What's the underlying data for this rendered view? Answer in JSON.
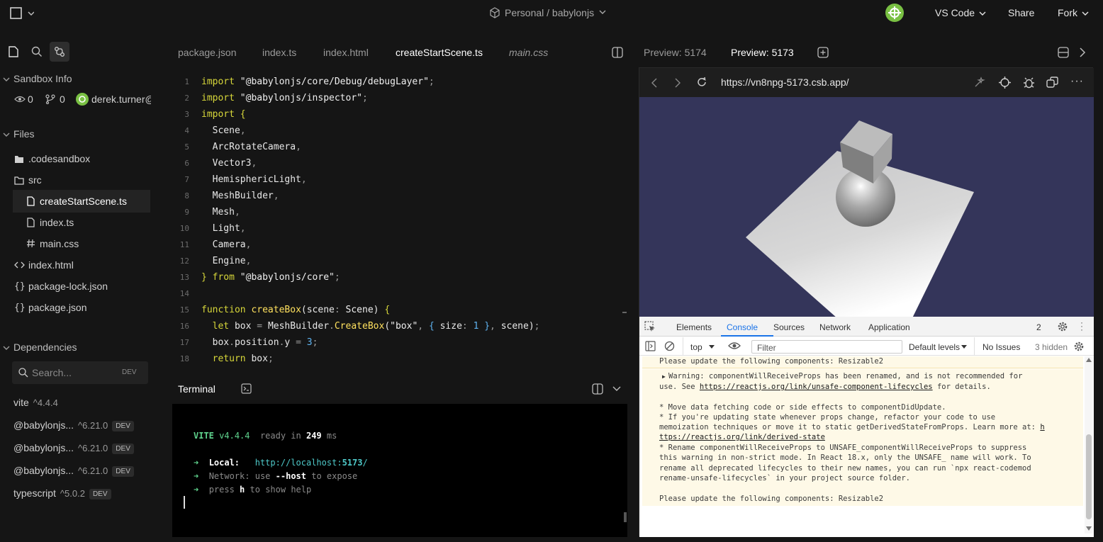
{
  "topbar": {
    "breadcrumb": "Personal / babylonjs",
    "editor_label": "VS Code",
    "share_label": "Share",
    "fork_label": "Fork"
  },
  "sidebar": {
    "sandbox_info_title": "Sandbox Info",
    "views": "0",
    "forks": "0",
    "author": "derek.turner@",
    "files_title": "Files",
    "files": [
      {
        "name": ".codesandbox",
        "icon": "folder-icon"
      },
      {
        "name": "src",
        "icon": "folder-open-icon"
      },
      {
        "name": "createStartScene.ts",
        "icon": "file-icon"
      },
      {
        "name": "index.ts",
        "icon": "file-icon"
      },
      {
        "name": "main.css",
        "icon": "hash-icon"
      },
      {
        "name": "index.html",
        "icon": "code-icon"
      },
      {
        "name": "package-lock.json",
        "icon": "braces-icon"
      },
      {
        "name": "package.json",
        "icon": "braces-icon"
      }
    ],
    "dependencies_title": "Dependencies",
    "search_placeholder": "Search...",
    "search_badge": "DEV",
    "dependencies": [
      {
        "name": "vite",
        "version": "^4.4.4",
        "dev": ""
      },
      {
        "name": "@babylonjs...",
        "version": "^6.21.0",
        "dev": "DEV"
      },
      {
        "name": "@babylonjs...",
        "version": "^6.21.0",
        "dev": "DEV"
      },
      {
        "name": "@babylonjs...",
        "version": "^6.21.0",
        "dev": "DEV"
      },
      {
        "name": "typescript",
        "version": "^5.0.2",
        "dev": "DEV"
      }
    ]
  },
  "editor": {
    "tabs": [
      "package.json",
      "index.ts",
      "index.html",
      "createStartScene.ts",
      "main.css"
    ],
    "active_tab": "createStartScene.ts",
    "line_numbers": [
      "1",
      "2",
      "3",
      "4",
      "5",
      "6",
      "7",
      "8",
      "9",
      "10",
      "11",
      "12",
      "13",
      "14",
      "15",
      "16",
      "17",
      "18"
    ]
  },
  "terminal": {
    "title": "Terminal",
    "vite": "VITE",
    "vite_version": "v4.4.4",
    "ready_text": "ready in",
    "ready_ms": "249",
    "ms_unit": "ms",
    "local_label": "Local:",
    "local_url_a": "http://localhost:",
    "local_url_port": "5173",
    "local_url_b": "/",
    "network_label": "Network:",
    "network_a": "use",
    "network_flag": "--host",
    "network_b": "to expose",
    "help_a": "press",
    "help_key": "h",
    "help_b": "to show help"
  },
  "preview": {
    "tabs": [
      "Preview: 5174",
      "Preview: 5173"
    ],
    "active_tab": "Preview: 5173",
    "url": "https://vn8npg-5173.csb.app/"
  },
  "devtools": {
    "tabs": [
      "Elements",
      "Console",
      "Sources",
      "Network",
      "Application"
    ],
    "active_tab": "Console",
    "issue_count": "2",
    "context": "top",
    "filter_placeholder": "Filter",
    "levels": "Default levels",
    "no_issues": "No Issues",
    "hidden": "3 hidden",
    "msg1": "Please update the following components: Resizable2",
    "warn_line1": "Warning: componentWillReceiveProps has been renamed, and is not recommended for",
    "warn_line2_a": "use. See",
    "warn_link1": "https://reactjs.org/link/unsafe-component-lifecycles",
    "warn_line2_b": "for details.",
    "warn_line3": "* Move data fetching code or side effects to componentDidUpdate.",
    "warn_line4": "* If you're updating state whenever props change, refactor your code to use",
    "warn_line5_a": "memoization techniques or move it to static getDerivedStateFromProps. Learn more at:",
    "warn_line5_b": "h",
    "warn_link2": "ttps://reactjs.org/link/derived-state",
    "warn_line6": "* Rename componentWillReceiveProps to UNSAFE_componentWillReceiveProps to suppress",
    "warn_line7": "this warning in non-strict mode. In React 18.x, only the UNSAFE_ name will work. To",
    "warn_line8": "rename all deprecated lifecycles to their new names, you can run `npx react-codemod",
    "warn_line9": "rename-unsafe-lifecycles` in your project source folder.",
    "msg2": "Please update the following components: Resizable2"
  },
  "colors": {
    "background": "#151515",
    "accent": "#1a73e8",
    "scene_background": "#34355a",
    "warning_background": "#fef9e7"
  }
}
